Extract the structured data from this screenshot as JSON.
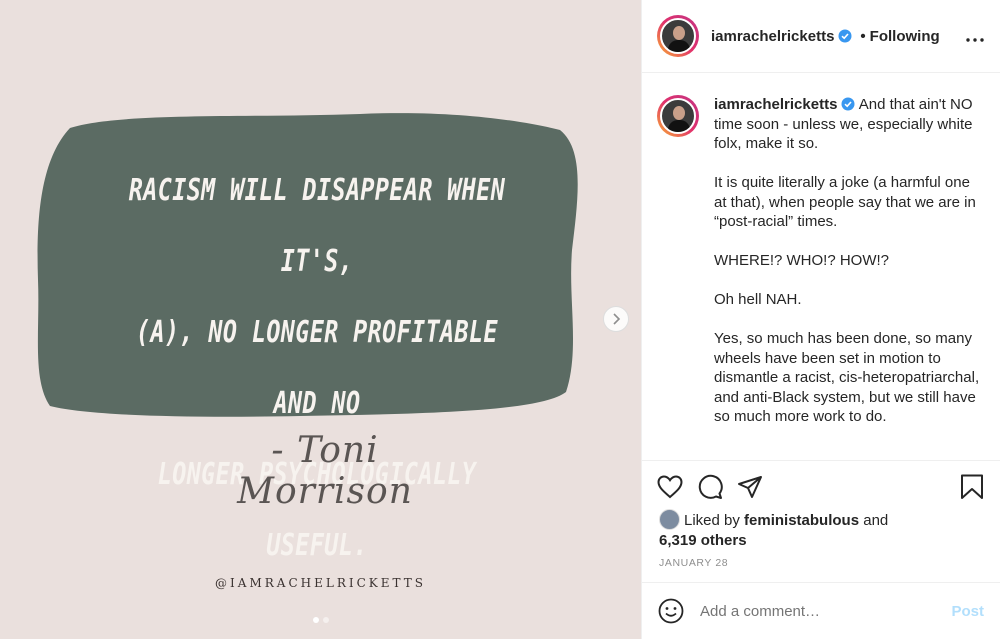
{
  "post_image": {
    "quote_lines": [
      "Racism will disappear when it's,",
      "(a), no longer profitable and no",
      "longer psychologically useful."
    ],
    "author": "- Toni Morrison",
    "watermark": "@IAMRACHELRICKETTS",
    "colors": {
      "background": "#eae0dd",
      "blob": "#5b6b63",
      "text": "#f7f3ef"
    },
    "carousel": {
      "total": 2,
      "current": 1
    }
  },
  "header": {
    "username": "iamrachelricketts",
    "separator": "•",
    "follow_status": "Following"
  },
  "caption": {
    "username": "iamrachelricketts",
    "first_line": "And that ain't NO time soon - unless we, especially white folx, make it so.",
    "paragraphs": [
      "It is quite literally a joke (a harmful one at that), when people say that we are in “post-racial” times.",
      "WHERE!? WHO!? HOW!?",
      "Oh hell NAH.",
      "Yes, so much has been done, so many wheels have been set in motion to dismantle a racist, cis-heteropatriarchal, and anti-Black system, but we still have so much more work to do."
    ]
  },
  "likes": {
    "prefix": "Liked by",
    "user": "feministabulous",
    "and": "and",
    "others": "6,319 others"
  },
  "date": "JANUARY 28",
  "comment": {
    "placeholder": "Add a comment…",
    "post_label": "Post"
  },
  "icons": {
    "like": "heart-icon",
    "comment": "comment-icon",
    "share": "share-icon",
    "save": "bookmark-icon",
    "emoji": "emoji-icon",
    "next": "chevron-right-icon",
    "verified": "verified-badge-icon",
    "more": "more-options-icon"
  }
}
